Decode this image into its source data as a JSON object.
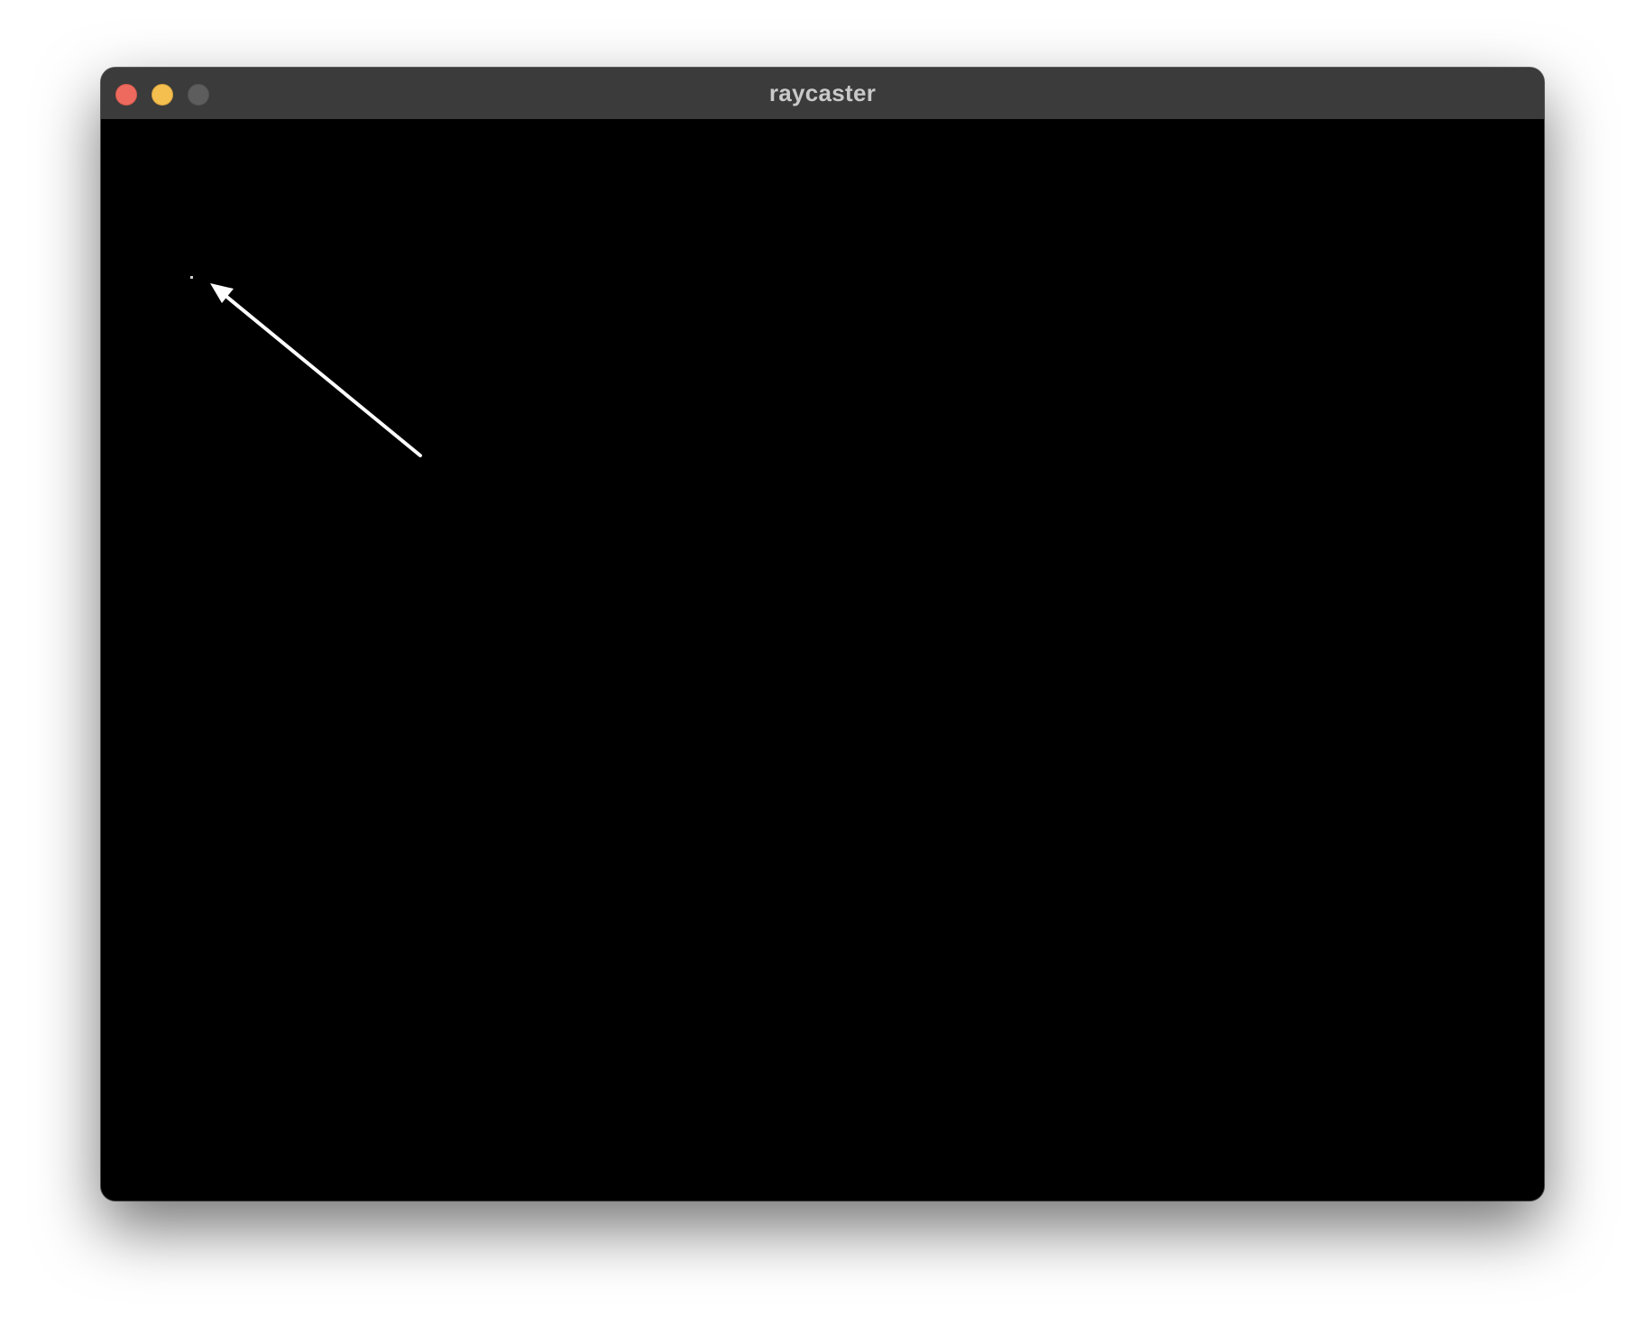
{
  "window": {
    "title": "raycaster",
    "traffic_lights": {
      "close": {
        "name": "close-icon",
        "color": "#ee6a5e"
      },
      "minimize": {
        "name": "minimize-icon",
        "color": "#f5bf4f"
      },
      "zoom": {
        "name": "zoom-icon",
        "color": "#5d5d5d"
      }
    },
    "canvas_background": "#000000"
  },
  "scene": {
    "player_dot_icon": "player-dot-icon",
    "annotation_arrow_icon": "annotation-arrow-icon",
    "arrow_color": "#ffffff"
  }
}
